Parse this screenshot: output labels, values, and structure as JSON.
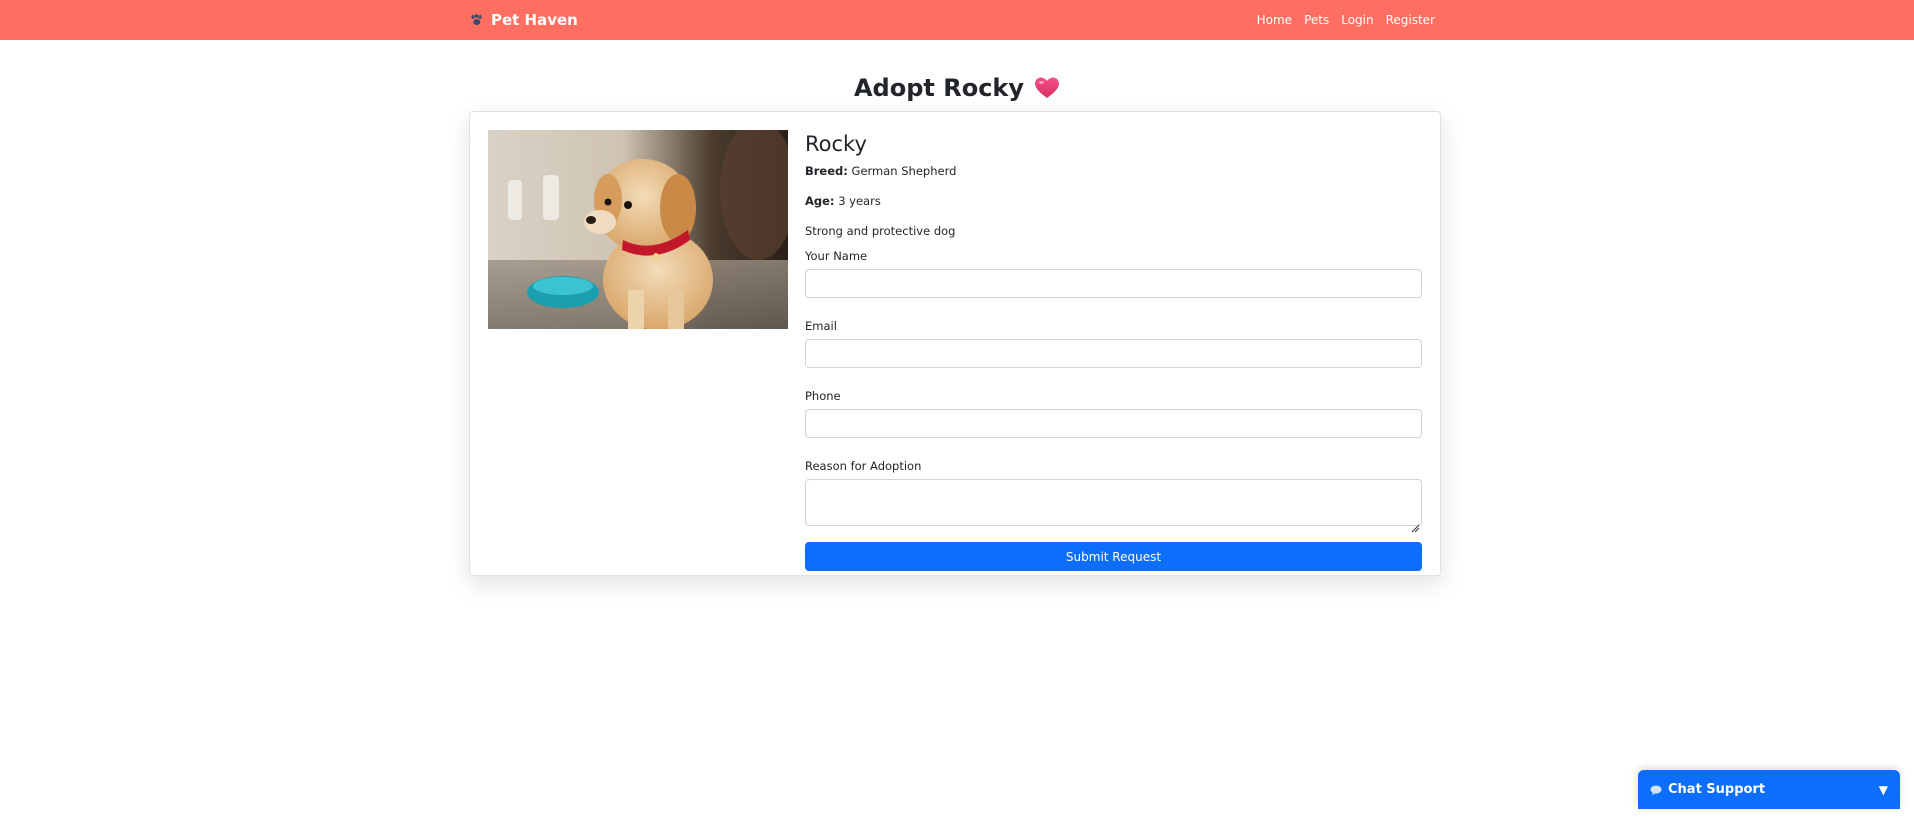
{
  "nav": {
    "brand": "Pet Haven",
    "links": [
      "Home",
      "Pets",
      "Login",
      "Register"
    ]
  },
  "page": {
    "heading": "Adopt Rocky"
  },
  "pet": {
    "name": "Rocky",
    "breed_label": "Breed:",
    "breed": "German Shepherd",
    "age_label": "Age:",
    "age": "3 years",
    "description": "Strong and protective dog"
  },
  "form": {
    "name_label": "Your Name",
    "name_value": "",
    "email_label": "Email",
    "email_value": "",
    "phone_label": "Phone",
    "phone_value": "",
    "reason_label": "Reason for Adoption",
    "reason_value": "",
    "submit_label": "Submit Request"
  },
  "chat": {
    "label": "Chat Support",
    "toggle": "▼"
  },
  "colors": {
    "navbar": "#ff6f61",
    "primary": "#0d6efd",
    "heart": "#e8356d"
  },
  "icons": {
    "brand": "paw-icon",
    "heading": "heart-icon",
    "chat": "speech-bubble-icon"
  }
}
